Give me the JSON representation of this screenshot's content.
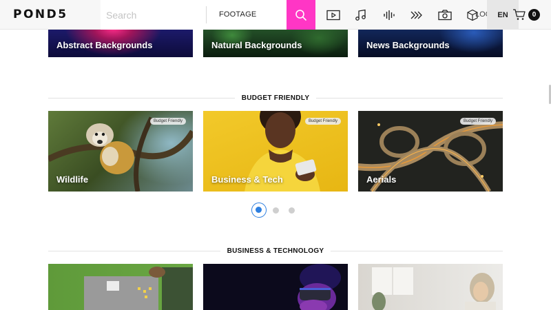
{
  "header": {
    "logo": "POND5",
    "search_placeholder": "Search",
    "media_type": "FOOTAGE",
    "login": "LOG IN",
    "language": "EN",
    "cart_count": "0",
    "icons": [
      "search-icon",
      "video-icon",
      "music-icon",
      "sound-effects-icon",
      "after-effects-icon",
      "photo-icon",
      "3d-icon",
      "cart-icon"
    ],
    "accent_color": "#ff36c5"
  },
  "top_row": {
    "cards": [
      {
        "label": "Abstract Backgrounds"
      },
      {
        "label": "Natural Backgrounds"
      },
      {
        "label": "News Backgrounds"
      }
    ]
  },
  "budget_section": {
    "title": "BUDGET FRIENDLY",
    "cards": [
      {
        "label": "Wildlife",
        "badge": "Budget Friendly"
      },
      {
        "label": "Business & Tech",
        "badge": "Budget Friendly"
      },
      {
        "label": "Aerials",
        "badge": "Budget Friendly"
      }
    ],
    "pagination": {
      "total": 3,
      "active": 1
    }
  },
  "business_section": {
    "title": "BUSINESS & TECHNOLOGY"
  }
}
